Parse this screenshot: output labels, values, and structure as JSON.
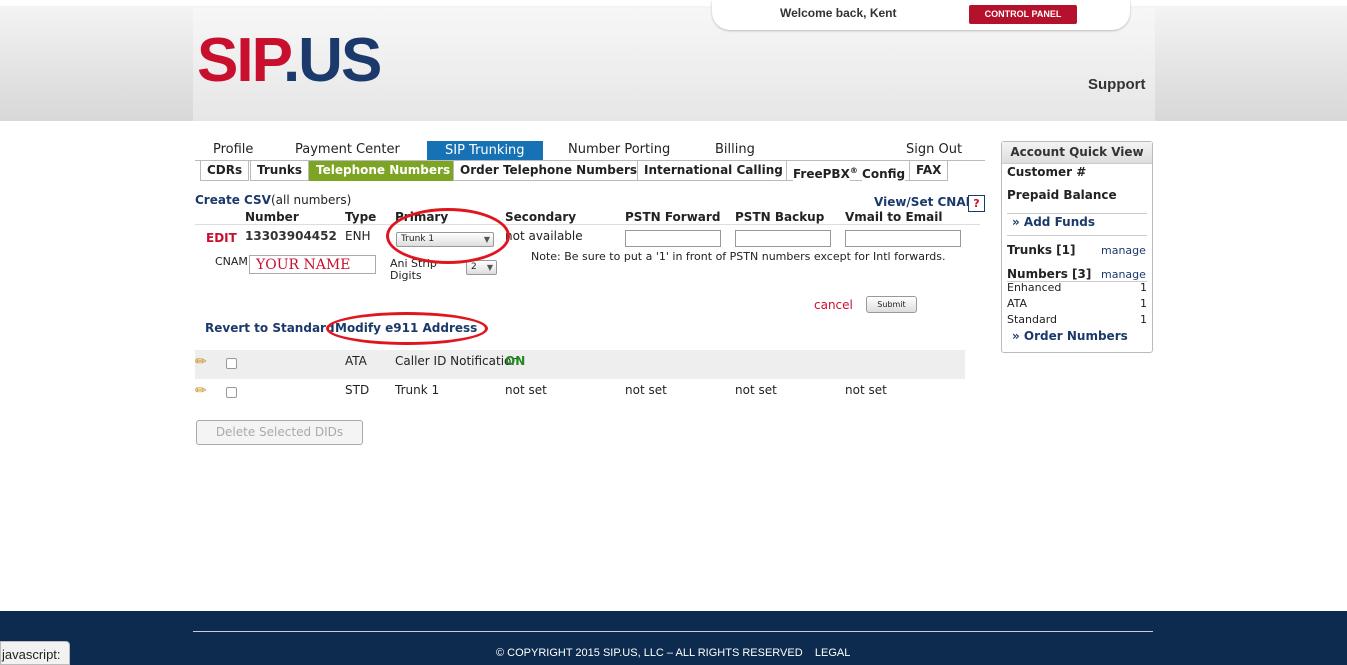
{
  "header": {
    "logo_part1": "SIP",
    "logo_part2": ".US",
    "welcome": "Welcome back, Kent",
    "control_panel": "CONTROL PANEL",
    "support": "Support"
  },
  "main_nav": [
    "Profile",
    "Payment Center",
    "SIP Trunking",
    "Number Porting",
    "Billing",
    "Sign Out"
  ],
  "sub_nav": [
    "CDRs",
    "Trunks",
    "Telephone Numbers",
    "Order Telephone Numbers",
    "International Calling",
    "FreePBX",
    "Config",
    "FAX"
  ],
  "sub_nav_reg": "®",
  "toolbar": {
    "create_csv": "Create CSV",
    "all_numbers": "(all numbers)",
    "view_set_cnam": "View/Set CNAM",
    "help": "?"
  },
  "columns": [
    "Number",
    "Type",
    "Primary",
    "Secondary",
    "PSTN Forward",
    "PSTN Backup",
    "Vmail to Email"
  ],
  "edit_row": {
    "edit": "EDIT",
    "number": "13303904452",
    "type": "ENH",
    "primary_select": "Trunk 1",
    "secondary": "not available",
    "cnam_label": "CNAM",
    "cnam_value": "YOUR NAME",
    "ani_strip_label": "Ani Strip Digits",
    "ani_strip_value": "2",
    "note": "Note: Be sure to put a '1' in front of PSTN numbers except for Intl forwards.",
    "cancel": "cancel",
    "submit": "Submit"
  },
  "links": {
    "revert": "Revert to Standard",
    "modify_e911": "Modify e911 Address"
  },
  "rows": [
    {
      "type": "ATA",
      "primary": "Caller ID Notification",
      "secondary": "ON",
      "pstn_forward": "",
      "pstn_backup": "",
      "vmail": ""
    },
    {
      "type": "STD",
      "primary": "Trunk 1",
      "secondary": "not set",
      "pstn_forward": "not set",
      "pstn_backup": "not set",
      "vmail": "not set"
    }
  ],
  "delete_button": "Delete Selected DIDs",
  "quick_view": {
    "title": "Account Quick View",
    "customer": "Customer #",
    "prepaid": "Prepaid Balance",
    "add_funds": "» Add Funds",
    "trunks": "Trunks [1]",
    "numbers": "Numbers [3]",
    "manage": "manage",
    "enhanced": "Enhanced",
    "enhanced_count": "1",
    "ata": "ATA",
    "ata_count": "1",
    "standard": "Standard",
    "standard_count": "1",
    "order_numbers": "» Order Numbers"
  },
  "footer": {
    "copyright": "© COPYRIGHT 2015 SIP.US, LLC – ALL RIGHTS RESERVED",
    "legal": "LEGAL"
  },
  "status_bar": "javascript:",
  "colors": {
    "brand_red": "#c8102e",
    "brand_blue": "#1b3a6b",
    "tab_active": "#1672b4",
    "subtab_active": "#7ea423",
    "footer": "#0c2b4e",
    "highlight_ellipse": "#e0161e"
  }
}
